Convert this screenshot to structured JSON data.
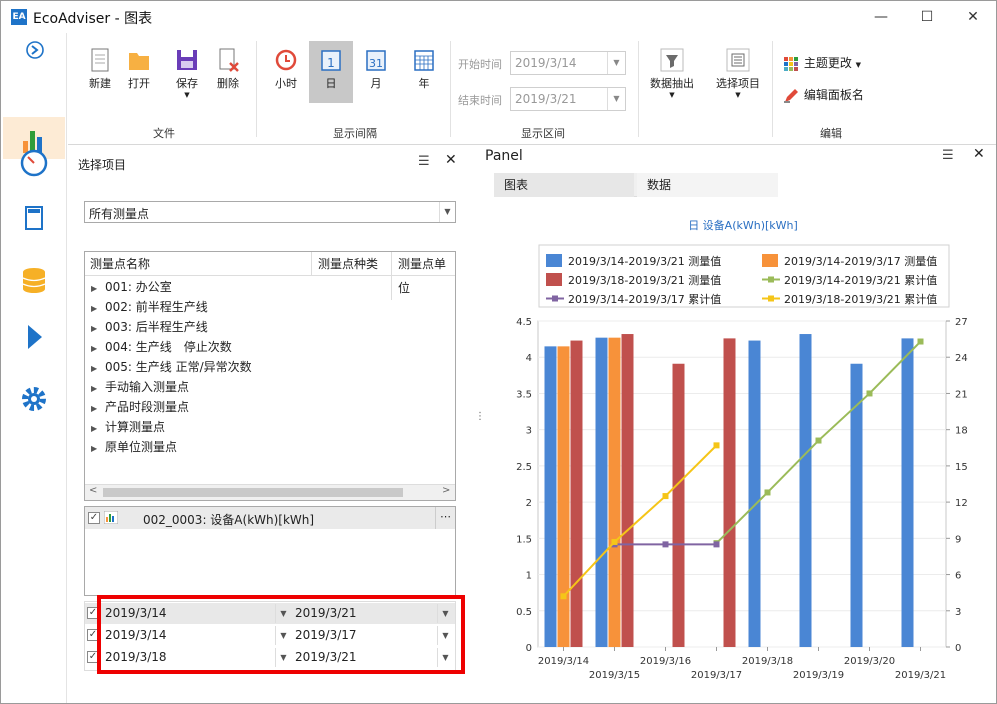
{
  "window": {
    "app_title": "EcoAdviser - 图表",
    "minimize": "—",
    "maximize": "☐",
    "close": "✕"
  },
  "nav": {
    "items": [
      "arrow-right-circle-icon",
      "bar-chart-icon",
      "gauge-icon",
      "document-icon",
      "database-icon",
      "play-icon",
      "gear-icon"
    ],
    "accent": "#1e73c8"
  },
  "ribbon": {
    "file": {
      "group": "文件",
      "new": "新建",
      "open": "打开",
      "save": "保存",
      "delete": "删除"
    },
    "interval": {
      "group": "显示间隔",
      "hour": "小时",
      "day": "日",
      "month": "月",
      "year": "年",
      "calendar_day": "1",
      "calendar_month": "31"
    },
    "range": {
      "group": "显示区间",
      "start_label": "开始时间",
      "start_value": "2019/3/14",
      "end_label": "结束时间",
      "end_value": "2019/3/21"
    },
    "extract": {
      "label": "数据抽出",
      "select": "选择项目"
    },
    "edit": {
      "group": "编辑",
      "theme": "主题更改",
      "rename": "编辑面板名"
    }
  },
  "left_panel": {
    "title": "选择项目",
    "filter_value": "所有测量点",
    "columns": [
      "测量点名称",
      "测量点种类",
      "测量点单位"
    ],
    "tree": [
      "001: 办公室",
      "002: 前半程生产线",
      "003: 后半程生产线",
      "004: 生产线　停止次数",
      "005: 生产线 正常/异常次数",
      "手动输入测量点",
      "产品时段测量点",
      "计算测量点",
      "原单位测量点"
    ],
    "selected_point": "002_0003: 设备A(kWh)[kWh]",
    "ranges": [
      {
        "start": "2019/3/14",
        "end": "2019/3/21"
      },
      {
        "start": "2019/3/14",
        "end": "2019/3/17"
      },
      {
        "start": "2019/3/18",
        "end": "2019/3/21"
      }
    ]
  },
  "right_panel": {
    "title": "Panel",
    "tabs": [
      "图表",
      "数据"
    ]
  },
  "chart_data": {
    "type": "bar",
    "title": "日 设备A(kWh)[kWh]",
    "categories": [
      "2019/3/14",
      "2019/3/15",
      "2019/3/16",
      "2019/3/17",
      "2019/3/18",
      "2019/3/19",
      "2019/3/20",
      "2019/3/21"
    ],
    "ylim": [
      0,
      4.5
    ],
    "y2lim": [
      0,
      27
    ],
    "yticks": [
      0,
      0.5,
      1,
      1.5,
      2,
      2.5,
      3,
      3.5,
      4,
      4.5
    ],
    "y2ticks": [
      0,
      3,
      6,
      9,
      12,
      15,
      18,
      21,
      24,
      27
    ],
    "grid": true,
    "legend_position": "top",
    "series": [
      {
        "name": "2019/3/14-2019/3/21 测量值",
        "kind": "bar",
        "color": "#4a86d4",
        "values": [
          4.15,
          4.27,
          null,
          null,
          4.23,
          4.32,
          3.91,
          4.26
        ]
      },
      {
        "name": "2019/3/14-2019/3/17 测量值",
        "kind": "bar",
        "color": "#f7923a",
        "values": [
          4.15,
          4.27,
          null,
          null,
          null,
          null,
          null,
          null
        ]
      },
      {
        "name": "2019/3/18-2019/3/21 测量值",
        "kind": "bar",
        "color": "#c0504d",
        "values": [
          4.23,
          4.32,
          3.91,
          4.26,
          null,
          null,
          null,
          null
        ]
      },
      {
        "name": "2019/3/14-2019/3/21 累计值",
        "kind": "line",
        "color": "#9bbb59",
        "values": [
          null,
          null,
          null,
          8.6,
          12.8,
          17.1,
          21.0,
          25.3
        ]
      },
      {
        "name": "2019/3/14-2019/3/17 累计值",
        "kind": "line",
        "color": "#8064a2",
        "values": [
          null,
          8.5,
          8.5,
          8.5,
          null,
          null,
          null,
          null
        ]
      },
      {
        "name": "2019/3/18-2019/3/21 累计值",
        "kind": "line",
        "color": "#f5c518",
        "values": [
          4.2,
          8.7,
          12.5,
          16.7,
          null,
          null,
          null,
          null
        ]
      }
    ]
  }
}
